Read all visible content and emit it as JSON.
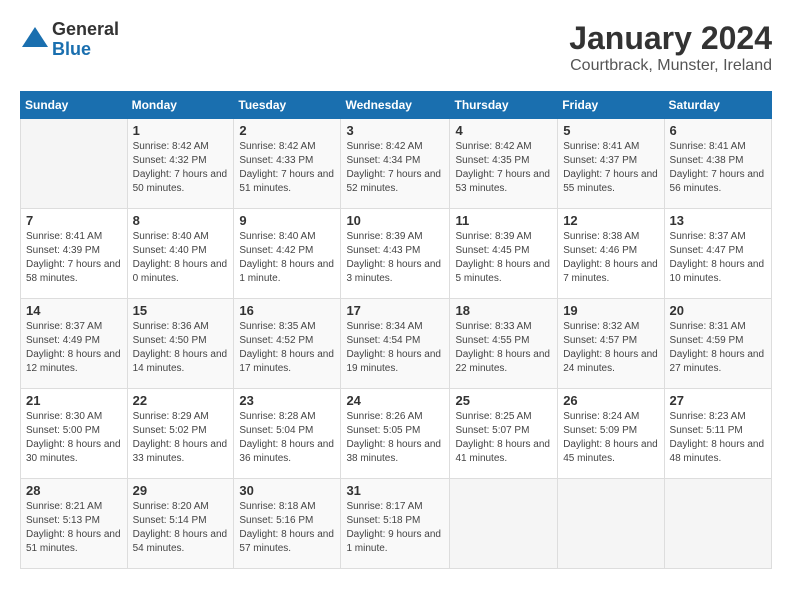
{
  "logo": {
    "general": "General",
    "blue": "Blue"
  },
  "title": "January 2024",
  "location": "Courtbrack, Munster, Ireland",
  "days_of_week": [
    "Sunday",
    "Monday",
    "Tuesday",
    "Wednesday",
    "Thursday",
    "Friday",
    "Saturday"
  ],
  "weeks": [
    [
      {
        "day": "",
        "sunrise": "",
        "sunset": "",
        "daylight": ""
      },
      {
        "day": "1",
        "sunrise": "Sunrise: 8:42 AM",
        "sunset": "Sunset: 4:32 PM",
        "daylight": "Daylight: 7 hours and 50 minutes."
      },
      {
        "day": "2",
        "sunrise": "Sunrise: 8:42 AM",
        "sunset": "Sunset: 4:33 PM",
        "daylight": "Daylight: 7 hours and 51 minutes."
      },
      {
        "day": "3",
        "sunrise": "Sunrise: 8:42 AM",
        "sunset": "Sunset: 4:34 PM",
        "daylight": "Daylight: 7 hours and 52 minutes."
      },
      {
        "day": "4",
        "sunrise": "Sunrise: 8:42 AM",
        "sunset": "Sunset: 4:35 PM",
        "daylight": "Daylight: 7 hours and 53 minutes."
      },
      {
        "day": "5",
        "sunrise": "Sunrise: 8:41 AM",
        "sunset": "Sunset: 4:37 PM",
        "daylight": "Daylight: 7 hours and 55 minutes."
      },
      {
        "day": "6",
        "sunrise": "Sunrise: 8:41 AM",
        "sunset": "Sunset: 4:38 PM",
        "daylight": "Daylight: 7 hours and 56 minutes."
      }
    ],
    [
      {
        "day": "7",
        "sunrise": "Sunrise: 8:41 AM",
        "sunset": "Sunset: 4:39 PM",
        "daylight": "Daylight: 7 hours and 58 minutes."
      },
      {
        "day": "8",
        "sunrise": "Sunrise: 8:40 AM",
        "sunset": "Sunset: 4:40 PM",
        "daylight": "Daylight: 8 hours and 0 minutes."
      },
      {
        "day": "9",
        "sunrise": "Sunrise: 8:40 AM",
        "sunset": "Sunset: 4:42 PM",
        "daylight": "Daylight: 8 hours and 1 minute."
      },
      {
        "day": "10",
        "sunrise": "Sunrise: 8:39 AM",
        "sunset": "Sunset: 4:43 PM",
        "daylight": "Daylight: 8 hours and 3 minutes."
      },
      {
        "day": "11",
        "sunrise": "Sunrise: 8:39 AM",
        "sunset": "Sunset: 4:45 PM",
        "daylight": "Daylight: 8 hours and 5 minutes."
      },
      {
        "day": "12",
        "sunrise": "Sunrise: 8:38 AM",
        "sunset": "Sunset: 4:46 PM",
        "daylight": "Daylight: 8 hours and 7 minutes."
      },
      {
        "day": "13",
        "sunrise": "Sunrise: 8:37 AM",
        "sunset": "Sunset: 4:47 PM",
        "daylight": "Daylight: 8 hours and 10 minutes."
      }
    ],
    [
      {
        "day": "14",
        "sunrise": "Sunrise: 8:37 AM",
        "sunset": "Sunset: 4:49 PM",
        "daylight": "Daylight: 8 hours and 12 minutes."
      },
      {
        "day": "15",
        "sunrise": "Sunrise: 8:36 AM",
        "sunset": "Sunset: 4:50 PM",
        "daylight": "Daylight: 8 hours and 14 minutes."
      },
      {
        "day": "16",
        "sunrise": "Sunrise: 8:35 AM",
        "sunset": "Sunset: 4:52 PM",
        "daylight": "Daylight: 8 hours and 17 minutes."
      },
      {
        "day": "17",
        "sunrise": "Sunrise: 8:34 AM",
        "sunset": "Sunset: 4:54 PM",
        "daylight": "Daylight: 8 hours and 19 minutes."
      },
      {
        "day": "18",
        "sunrise": "Sunrise: 8:33 AM",
        "sunset": "Sunset: 4:55 PM",
        "daylight": "Daylight: 8 hours and 22 minutes."
      },
      {
        "day": "19",
        "sunrise": "Sunrise: 8:32 AM",
        "sunset": "Sunset: 4:57 PM",
        "daylight": "Daylight: 8 hours and 24 minutes."
      },
      {
        "day": "20",
        "sunrise": "Sunrise: 8:31 AM",
        "sunset": "Sunset: 4:59 PM",
        "daylight": "Daylight: 8 hours and 27 minutes."
      }
    ],
    [
      {
        "day": "21",
        "sunrise": "Sunrise: 8:30 AM",
        "sunset": "Sunset: 5:00 PM",
        "daylight": "Daylight: 8 hours and 30 minutes."
      },
      {
        "day": "22",
        "sunrise": "Sunrise: 8:29 AM",
        "sunset": "Sunset: 5:02 PM",
        "daylight": "Daylight: 8 hours and 33 minutes."
      },
      {
        "day": "23",
        "sunrise": "Sunrise: 8:28 AM",
        "sunset": "Sunset: 5:04 PM",
        "daylight": "Daylight: 8 hours and 36 minutes."
      },
      {
        "day": "24",
        "sunrise": "Sunrise: 8:26 AM",
        "sunset": "Sunset: 5:05 PM",
        "daylight": "Daylight: 8 hours and 38 minutes."
      },
      {
        "day": "25",
        "sunrise": "Sunrise: 8:25 AM",
        "sunset": "Sunset: 5:07 PM",
        "daylight": "Daylight: 8 hours and 41 minutes."
      },
      {
        "day": "26",
        "sunrise": "Sunrise: 8:24 AM",
        "sunset": "Sunset: 5:09 PM",
        "daylight": "Daylight: 8 hours and 45 minutes."
      },
      {
        "day": "27",
        "sunrise": "Sunrise: 8:23 AM",
        "sunset": "Sunset: 5:11 PM",
        "daylight": "Daylight: 8 hours and 48 minutes."
      }
    ],
    [
      {
        "day": "28",
        "sunrise": "Sunrise: 8:21 AM",
        "sunset": "Sunset: 5:13 PM",
        "daylight": "Daylight: 8 hours and 51 minutes."
      },
      {
        "day": "29",
        "sunrise": "Sunrise: 8:20 AM",
        "sunset": "Sunset: 5:14 PM",
        "daylight": "Daylight: 8 hours and 54 minutes."
      },
      {
        "day": "30",
        "sunrise": "Sunrise: 8:18 AM",
        "sunset": "Sunset: 5:16 PM",
        "daylight": "Daylight: 8 hours and 57 minutes."
      },
      {
        "day": "31",
        "sunrise": "Sunrise: 8:17 AM",
        "sunset": "Sunset: 5:18 PM",
        "daylight": "Daylight: 9 hours and 1 minute."
      },
      {
        "day": "",
        "sunrise": "",
        "sunset": "",
        "daylight": ""
      },
      {
        "day": "",
        "sunrise": "",
        "sunset": "",
        "daylight": ""
      },
      {
        "day": "",
        "sunrise": "",
        "sunset": "",
        "daylight": ""
      }
    ]
  ]
}
